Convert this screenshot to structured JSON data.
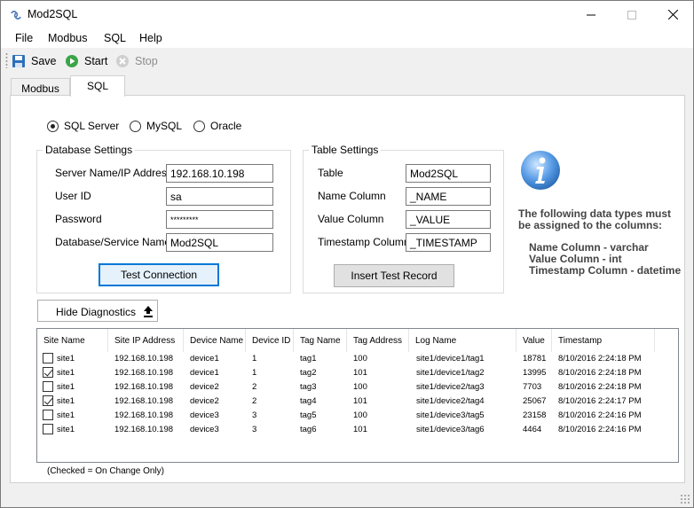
{
  "window": {
    "title": "Mod2SQL"
  },
  "menu": [
    "File",
    "Modbus",
    "SQL",
    "Help"
  ],
  "toolbar": {
    "save": "Save",
    "start": "Start",
    "stop": "Stop"
  },
  "tabs": [
    "Modbus",
    "SQL"
  ],
  "db_types": [
    {
      "label": "SQL Server",
      "selected": true
    },
    {
      "label": "MySQL",
      "selected": false
    },
    {
      "label": "Oracle",
      "selected": false
    }
  ],
  "database_settings": {
    "title": "Database Settings",
    "server_label": "Server Name/IP Address",
    "server_value": "192.168.10.198",
    "user_label": "User ID",
    "user_value": "sa",
    "password_label": "Password",
    "password_value": "*********",
    "dbname_label": "Database/Service Name",
    "dbname_value": "Mod2SQL",
    "test_button": "Test Connection"
  },
  "table_settings": {
    "title": "Table Settings",
    "table_label": "Table",
    "table_value": "Mod2SQL",
    "name_label": "Name Column",
    "name_value": "_NAME",
    "value_label": "Value Column",
    "value_value": "_VALUE",
    "timestamp_label": "Timestamp Column",
    "timestamp_value": "_TIMESTAMP",
    "insert_button": "Insert Test Record"
  },
  "info": {
    "line1": "The following data types must",
    "line2": "be assigned to the columns:",
    "line3": "Name Column - varchar",
    "line4": "Value Column - int",
    "line5": "Timestamp Column - datetime"
  },
  "diagnostics_button": "Hide Diagnostics",
  "grid": {
    "columns": [
      "Site Name",
      "Site IP Address",
      "Device Name",
      "Device ID",
      "Tag Name",
      "Tag Address",
      "Log Name",
      "Value",
      "Timestamp"
    ],
    "rows": [
      {
        "checked": false,
        "site": "site1",
        "ip": "192.168.10.198",
        "device": "device1",
        "device_id": "1",
        "tag": "tag1",
        "address": "100",
        "log": "site1/device1/tag1",
        "value": "18781",
        "timestamp": "8/10/2016 2:24:18 PM"
      },
      {
        "checked": true,
        "site": "site1",
        "ip": "192.168.10.198",
        "device": "device1",
        "device_id": "1",
        "tag": "tag2",
        "address": "101",
        "log": "site1/device1/tag2",
        "value": "13995",
        "timestamp": "8/10/2016 2:24:18 PM"
      },
      {
        "checked": false,
        "site": "site1",
        "ip": "192.168.10.198",
        "device": "device2",
        "device_id": "2",
        "tag": "tag3",
        "address": "100",
        "log": "site1/device2/tag3",
        "value": "7703",
        "timestamp": "8/10/2016 2:24:18 PM"
      },
      {
        "checked": true,
        "site": "site1",
        "ip": "192.168.10.198",
        "device": "device2",
        "device_id": "2",
        "tag": "tag4",
        "address": "101",
        "log": "site1/device2/tag4",
        "value": "25067",
        "timestamp": "8/10/2016 2:24:17 PM"
      },
      {
        "checked": false,
        "site": "site1",
        "ip": "192.168.10.198",
        "device": "device3",
        "device_id": "3",
        "tag": "tag5",
        "address": "100",
        "log": "site1/device3/tag5",
        "value": "23158",
        "timestamp": "8/10/2016 2:24:16 PM"
      },
      {
        "checked": false,
        "site": "site1",
        "ip": "192.168.10.198",
        "device": "device3",
        "device_id": "3",
        "tag": "tag6",
        "address": "101",
        "log": "site1/device3/tag6",
        "value": "4464",
        "timestamp": "8/10/2016 2:24:16 PM"
      }
    ]
  },
  "footnote": "(Checked = On Change Only)"
}
